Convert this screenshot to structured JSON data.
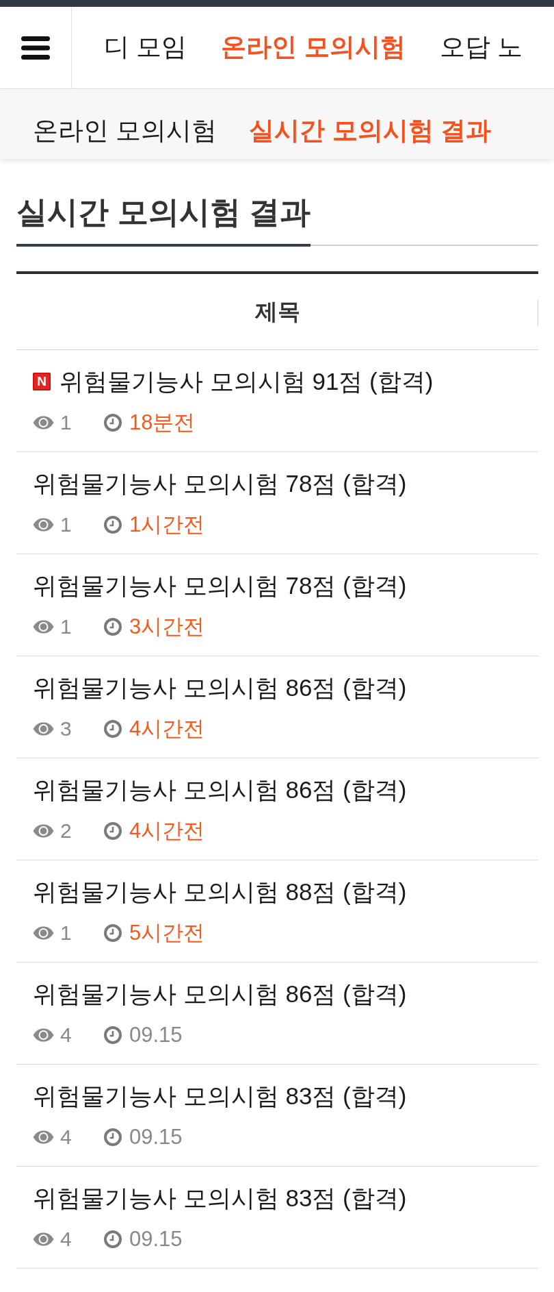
{
  "nav": {
    "items": [
      {
        "label": "디 모임",
        "selected": false
      },
      {
        "label": "온라인 모의시험",
        "selected": true
      },
      {
        "label": "오답 노",
        "selected": false
      }
    ]
  },
  "subnav": {
    "items": [
      {
        "label": "온라인 모의시험",
        "selected": false
      },
      {
        "label": "실시간 모의시험 결과",
        "selected": true
      }
    ]
  },
  "page_title": "실시간 모의시험 결과",
  "table": {
    "columns": [
      "제목"
    ],
    "rows": [
      {
        "badge": "N",
        "title": "위험물기능사 모의시험 91점 (합격)",
        "views": "1",
        "time": "18분전",
        "recent": true
      },
      {
        "title": "위험물기능사 모의시험 78점 (합격)",
        "views": "1",
        "time": "1시간전",
        "recent": true
      },
      {
        "title": "위험물기능사 모의시험 78점 (합격)",
        "views": "1",
        "time": "3시간전",
        "recent": true
      },
      {
        "title": "위험물기능사 모의시험 86점 (합격)",
        "views": "3",
        "time": "4시간전",
        "recent": true
      },
      {
        "title": "위험물기능사 모의시험 86점 (합격)",
        "views": "2",
        "time": "4시간전",
        "recent": true
      },
      {
        "title": "위험물기능사 모의시험 88점 (합격)",
        "views": "1",
        "time": "5시간전",
        "recent": true
      },
      {
        "title": "위험물기능사 모의시험 86점 (합격)",
        "views": "4",
        "time": "09.15",
        "recent": false
      },
      {
        "title": "위험물기능사 모의시험 83점 (합격)",
        "views": "4",
        "time": "09.15",
        "recent": false
      },
      {
        "title": "위험물기능사 모의시험 83점 (합격)",
        "views": "4",
        "time": "09.15",
        "recent": false
      }
    ]
  }
}
